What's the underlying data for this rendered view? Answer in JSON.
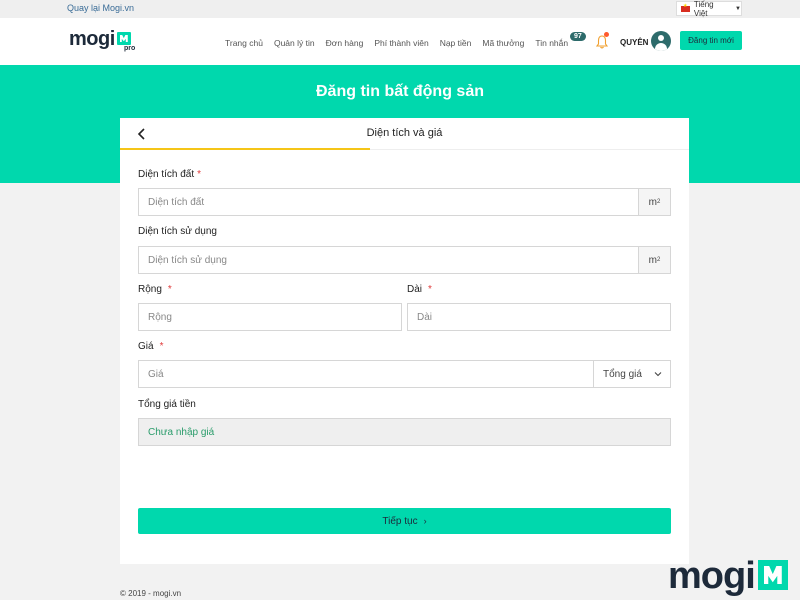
{
  "topbar": {
    "back_link": "Quay lại Mogi.vn",
    "language": "Tiếng Việt"
  },
  "header": {
    "logo_text": "mogi",
    "logo_sub": "pro",
    "nav": [
      {
        "label": "Trang chủ"
      },
      {
        "label": "Quản lý tin"
      },
      {
        "label": "Đơn hàng"
      },
      {
        "label": "Phí thành viên"
      },
      {
        "label": "Nạp tiền"
      },
      {
        "label": "Mã thưởng"
      },
      {
        "label": "Tin nhắn"
      }
    ],
    "message_count": "97",
    "user_name": "QUYÊN",
    "post_button": "Đăng tin mới"
  },
  "hero": {
    "title": "Đăng tin bất động sản"
  },
  "card": {
    "title": "Diện tích và giá",
    "progress_fraction": 0.44
  },
  "form": {
    "land_area": {
      "label": "Diện tích đất",
      "placeholder": "Diện tích đất",
      "unit": "m",
      "unit_sup": "2"
    },
    "used_area": {
      "label": "Diện tích sử dụng",
      "placeholder": "Diện tích sử dụng",
      "unit": "m",
      "unit_sup": "2"
    },
    "width": {
      "label": "Rộng",
      "placeholder": "Rộng"
    },
    "length": {
      "label": "Dài",
      "placeholder": "Dài"
    },
    "price": {
      "label": "Giá",
      "placeholder": "Giá",
      "select_value": "Tổng giá"
    },
    "total": {
      "label": "Tổng giá tiền",
      "value": "Chưa nhập giá"
    },
    "required_mark": "*",
    "continue_label": "Tiếp tục"
  },
  "footer": {
    "copyright": "© 2019 - mogi.vn"
  },
  "watermark": {
    "text": "mogi"
  },
  "colors": {
    "accent": "#00d8ad",
    "progress": "#f5c518",
    "required": "#e03a3a",
    "dark": "#1d2a3a"
  }
}
